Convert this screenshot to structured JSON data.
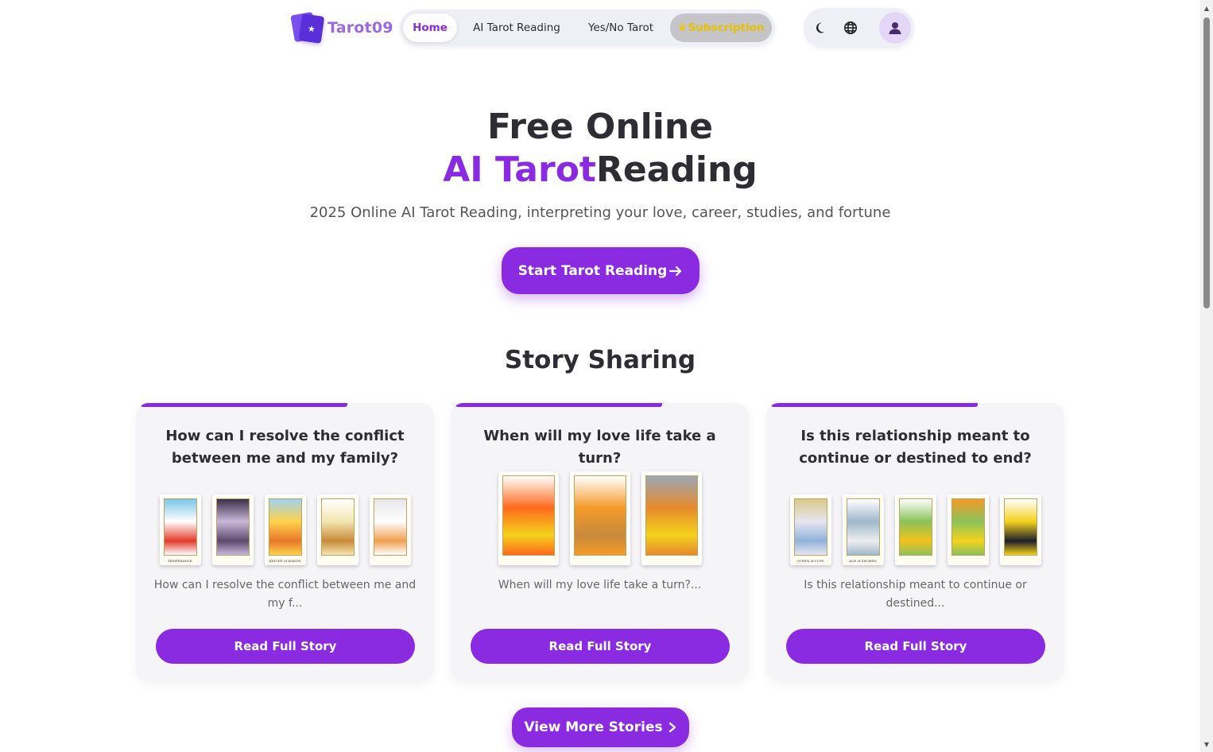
{
  "brand": {
    "name": "Tarot09",
    "accent": "#8a2be2"
  },
  "nav": {
    "home": "Home",
    "ai_reading": "AI Tarot Reading",
    "yes_no": "Yes/No Tarot",
    "subscription": "Subscription"
  },
  "tools": {
    "theme_icon": "moon-icon",
    "language_icon": "globe-icon",
    "avatar_icon": "user-icon"
  },
  "hero": {
    "title_line1": "Free Online",
    "title_accent": "AI Tarot",
    "title_rest": "Reading",
    "subtitle": "2025 Online AI Tarot Reading, interpreting your love, career, studies, and fortune",
    "cta": "Start Tarot Reading"
  },
  "stories": {
    "heading": "Story Sharing",
    "items": [
      {
        "question": "How can I resolve the conflict between me and my family?",
        "excerpt": "How can I resolve the conflict between me and my f...",
        "button": "Read Full Story",
        "cards": [
          {
            "name": "TEMPERANCE",
            "palette": [
              "#e33b2c",
              "#ffffff",
              "#7bc6e8"
            ]
          },
          {
            "name": "",
            "palette": [
              "#5b4a6e",
              "#c9b8d8",
              "#3a2e48"
            ]
          },
          {
            "name": "KNIGHT of WANDS",
            "palette": [
              "#e8772a",
              "#ffd24a",
              "#9fd3ef"
            ]
          },
          {
            "name": "",
            "palette": [
              "#c88a3a",
              "#f4e6b0",
              "#ffffff"
            ]
          },
          {
            "name": "",
            "palette": [
              "#f0a050",
              "#ffffff",
              "#e6e6e6"
            ]
          }
        ]
      },
      {
        "question": "When will my love life take a turn?",
        "excerpt": "When will my love life take a turn?...",
        "button": "Read Full Story",
        "cards": [
          {
            "name": "",
            "palette": [
              "#f4d21c",
              "#ff6a1c",
              "#ffffff"
            ]
          },
          {
            "name": "",
            "palette": [
              "#c88a3a",
              "#f49b2a",
              "#ffffff"
            ]
          },
          {
            "name": "",
            "palette": [
              "#f4d21c",
              "#e68a2c",
              "#9aa7b8"
            ]
          }
        ]
      },
      {
        "question": "Is this relationship meant to continue or destined to end?",
        "excerpt": "Is this relationship meant to continue or destined...",
        "button": "Read Full Story",
        "cards": [
          {
            "name": "QUEEN of CUPS",
            "palette": [
              "#8fb4d8",
              "#e6e6f2",
              "#d9c98a"
            ]
          },
          {
            "name": "ACE of SWORDS",
            "palette": [
              "#eeeeee",
              "#9fb8cc",
              "#ffffff"
            ]
          },
          {
            "name": "",
            "palette": [
              "#f4c21c",
              "#8bc25a",
              "#ffffff"
            ]
          },
          {
            "name": "",
            "palette": [
              "#f4d21c",
              "#8bc25a",
              "#f49b2a"
            ]
          },
          {
            "name": "",
            "palette": [
              "#1e1e2a",
              "#f4d21c",
              "#ffffff"
            ]
          }
        ]
      }
    ],
    "more": "View More Stories"
  }
}
